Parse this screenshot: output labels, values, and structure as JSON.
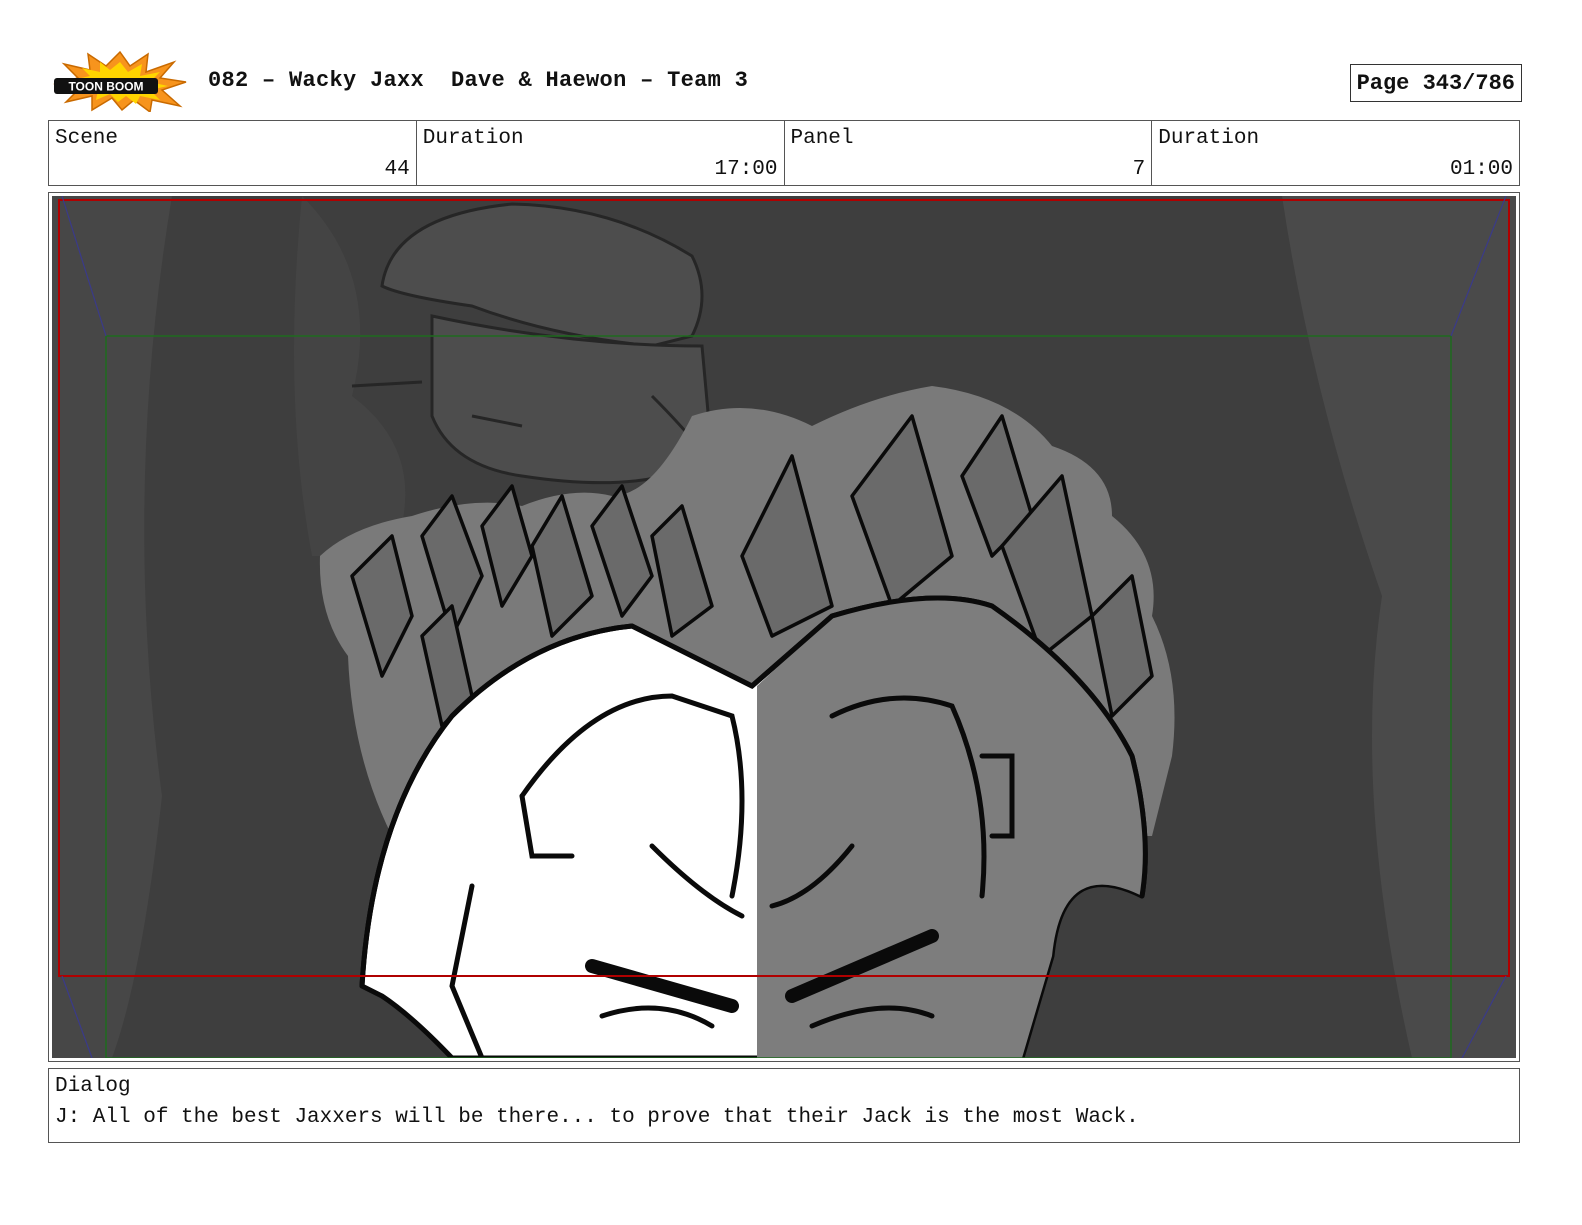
{
  "header": {
    "logo_text": "TOON BOOM",
    "title": "082 – Wacky Jaxx  Dave & Haewon – Team 3",
    "page": "Page 343/786"
  },
  "info": {
    "scene_label": "Scene",
    "scene_value": "44",
    "scene_duration_label": "Duration",
    "scene_duration_value": "17:00",
    "panel_label": "Panel",
    "panel_value": "7",
    "panel_duration_label": "Duration",
    "panel_duration_value": "01:00"
  },
  "dialog": {
    "label": "Dialog",
    "text": "J: All of the best Jaxxers will be there... to prove that their Jack is the most Wack."
  },
  "colors": {
    "logo_orange": "#f7941d",
    "logo_yellow": "#ffd400",
    "background_dark": "#3e3e3e",
    "crowd_gray": "#7a7a7a",
    "safe_frame_red": "#b00000",
    "action_frame_green": "#1e6b1e",
    "camera_blue": "#3a3a8a"
  }
}
